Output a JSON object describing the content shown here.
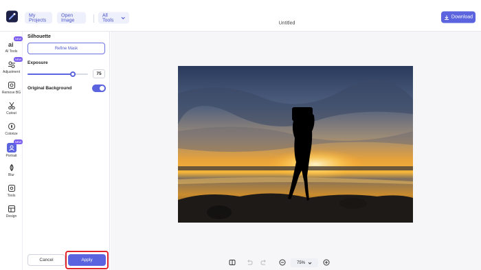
{
  "header": {
    "my_projects": "My Projects",
    "open_image": "Open Image",
    "all_tools": "All Tools",
    "title": "Untitled",
    "download": "Download"
  },
  "rail": {
    "items": [
      {
        "label": "AI Tools",
        "icon": "ai-icon",
        "badge": "NEW"
      },
      {
        "label": "Adjustment",
        "icon": "adjustment-icon",
        "badge": "NEW"
      },
      {
        "label": "Remove BG",
        "icon": "remove-bg-icon"
      },
      {
        "label": "Cutout",
        "icon": "scissors-icon"
      },
      {
        "label": "Colorize",
        "icon": "colorize-icon"
      },
      {
        "label": "Portrait",
        "icon": "portrait-icon",
        "badge": "NEW",
        "active": true
      },
      {
        "label": "Blur",
        "icon": "blur-icon"
      },
      {
        "label": "Tools",
        "icon": "tools-icon"
      },
      {
        "label": "Design",
        "icon": "design-icon"
      }
    ]
  },
  "panel": {
    "title": "Silhouette",
    "refine_mask": "Refine Mask",
    "exposure_label": "Exposure",
    "exposure_value": "75",
    "exposure_fraction": 0.75,
    "original_bg_label": "Original Background",
    "original_bg_on": true,
    "cancel": "Cancel",
    "apply": "Apply"
  },
  "bottom": {
    "zoom": "75%"
  },
  "colors": {
    "accent": "#5b63de",
    "highlight": "#e0242a"
  }
}
